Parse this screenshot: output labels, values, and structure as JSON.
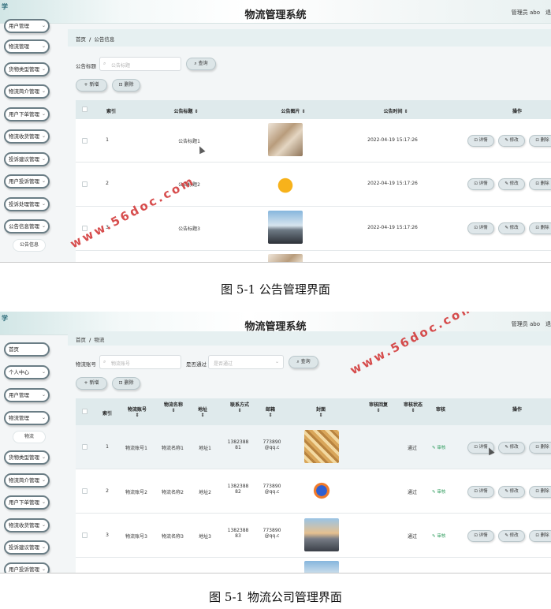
{
  "watermark": "www.56doc.com",
  "screenshot1": {
    "app_title": "物流管理系统",
    "admin_label": "管理员 abo",
    "exit_label": "退",
    "logo": "学",
    "sidebar": [
      {
        "label": "用户管理",
        "chev": "⌄"
      },
      {
        "label": "物流管理",
        "chev": "⌄"
      },
      {
        "label": "货物类型管理",
        "chev": "⌄"
      },
      {
        "label": "物流简介管理",
        "chev": "⌄"
      },
      {
        "label": "用户下单管理",
        "chev": "⌄"
      },
      {
        "label": "物流收货管理",
        "chev": "⌄"
      },
      {
        "label": "投诉建议管理",
        "chev": "⌄"
      },
      {
        "label": "用户投诉管理",
        "chev": "⌄"
      },
      {
        "label": "投诉处理管理",
        "chev": "⌄"
      },
      {
        "label": "公告信息管理",
        "chev": "⌄"
      }
    ],
    "sidebar_sub": "公告信息",
    "breadcrumb": {
      "home": "首页",
      "sep": "/",
      "current": "公告信息"
    },
    "search_label": "公告标题",
    "search_placeholder": "公告标题",
    "search_icon": "⌕",
    "query_button": "⌕ 查询",
    "add_button": "+ 新增",
    "delete_button": "⊡ 删除",
    "columns": [
      "索引",
      "公告标题 ⇕",
      "公告图片 ⇕",
      "公告时间 ⇕",
      "操作"
    ],
    "rows": [
      {
        "index": "1",
        "title": "公告标题1",
        "time": "2022-04-19 15:17:26"
      },
      {
        "index": "2",
        "title": "公告标题2",
        "time": "2022-04-19 15:17:26"
      },
      {
        "index": "3",
        "title": "公告标题3",
        "time": "2022-04-19 15:17:26"
      }
    ],
    "actions": {
      "detail": "⊡ 详情",
      "edit": "✎ 修改",
      "delete": "⊡ 删除"
    }
  },
  "caption1": "图 5-1  公告管理界面",
  "screenshot2": {
    "app_title": "物流管理系统",
    "admin_label": "管理员 abo",
    "exit_label": "退",
    "logo": "学",
    "sidebar": [
      {
        "label": "首页",
        "chev": ""
      },
      {
        "label": "个人中心",
        "chev": "⌄"
      },
      {
        "label": "用户管理",
        "chev": "⌄"
      },
      {
        "label": "物流管理",
        "chev": "⌄"
      },
      {
        "label": "货物类型管理",
        "chev": "⌄"
      },
      {
        "label": "物流简介管理",
        "chev": "⌄"
      },
      {
        "label": "用户下单管理",
        "chev": "⌄"
      },
      {
        "label": "物流收货管理",
        "chev": "⌄"
      },
      {
        "label": "投诉建议管理",
        "chev": "⌄"
      },
      {
        "label": "用户投诉管理",
        "chev": "⌄"
      }
    ],
    "sidebar_sub": "物流",
    "breadcrumb": {
      "home": "首页",
      "sep": "/",
      "current": "物流"
    },
    "search": {
      "label1": "物流账号",
      "placeholder1": "物流账号",
      "label2": "是否通过",
      "placeholder2": "是否通过",
      "search_icon": "⌕",
      "select_chev": "⌄"
    },
    "query_button": "⌕ 查询",
    "add_button": "+ 新增",
    "delete_button": "⊡ 删除",
    "columns": [
      {
        "title": "索引",
        "sort": ""
      },
      {
        "title": "物流账号",
        "sort": "⇕"
      },
      {
        "title": "物流名称",
        "sort": "⇕"
      },
      {
        "title": "地址",
        "sort": "⇕"
      },
      {
        "title": "联系方式",
        "sort": "⇕"
      },
      {
        "title": "邮箱",
        "sort": "⇕"
      },
      {
        "title": "封面",
        "sort": "⇕"
      },
      {
        "title": "审核回复",
        "sort": "⇕"
      },
      {
        "title": "审核状态",
        "sort": "⇕"
      },
      {
        "title": "审核",
        "sort": ""
      },
      {
        "title": "操作",
        "sort": ""
      }
    ],
    "rows": [
      {
        "index": "1",
        "account": "物流账号1",
        "name": "物流名称1",
        "address": "地址1",
        "phone1": "1382388",
        "phone2": "81",
        "email1": "773890",
        "email2": "@qq.c",
        "status": "通过",
        "audit": "✎ 审核"
      },
      {
        "index": "2",
        "account": "物流账号2",
        "name": "物流名称2",
        "address": "地址2",
        "phone1": "1382388",
        "phone2": "82",
        "email1": "773890",
        "email2": "@qq.c",
        "status": "通过",
        "audit": "✎ 审核"
      },
      {
        "index": "3",
        "account": "物流账号3",
        "name": "物流名称3",
        "address": "地址3",
        "phone1": "1382388",
        "phone2": "83",
        "email1": "773890",
        "email2": "@qq.c",
        "status": "通过",
        "audit": "✎ 审核"
      }
    ],
    "actions": {
      "detail": "⊡ 详情",
      "edit": "✎ 修改",
      "delete": "⊡ 删除"
    }
  },
  "caption2": "图 5-1  物流公司管理界面"
}
